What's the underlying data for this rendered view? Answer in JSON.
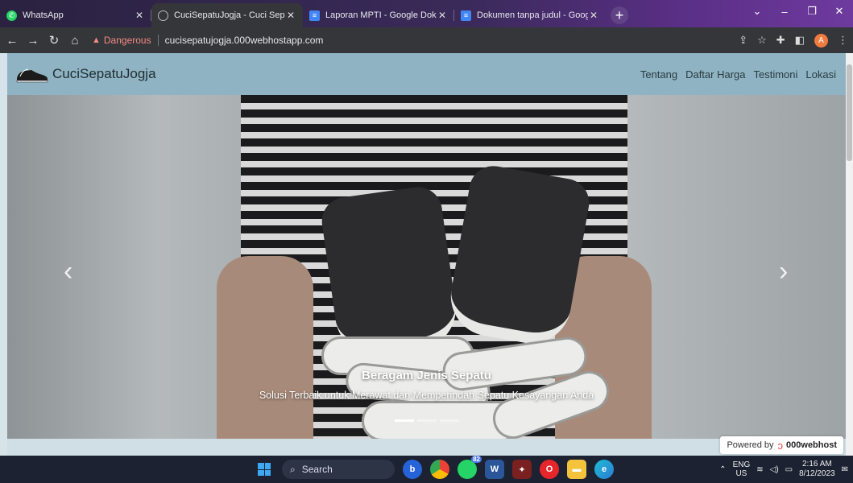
{
  "browser": {
    "tabs": [
      {
        "title": "WhatsApp",
        "icon": "whatsapp-icon",
        "icon_color": "#25d366"
      },
      {
        "title": "CuciSepatuJogja - Cuci Sepatu Pr",
        "icon": "globe-icon",
        "icon_color": "#9aa0a6",
        "active": true
      },
      {
        "title": "Laporan MPTI - Google Dokumen",
        "icon": "google-docs-icon",
        "icon_color": "#4285f4"
      },
      {
        "title": "Dokumen tanpa judul - Google D",
        "icon": "google-docs-icon",
        "icon_color": "#4285f4"
      }
    ],
    "security_label": "Dangerous",
    "url": "cucisepatujogja.000webhostapp.com",
    "profile_initial": "A"
  },
  "site": {
    "brand": "CuciSepatuJogja",
    "nav": [
      "Tentang",
      "Daftar Harga",
      "Testimoni",
      "Lokasi"
    ],
    "carousel": {
      "title": "Beragam Jenis Sepatu",
      "subtitle": "Solusi Terbaik untuk Merawat dan Memperindah Sepatu Kesayangan Anda",
      "slide_count": 3,
      "active_slide": 1,
      "prev_label": "‹",
      "next_label": "›"
    },
    "powered_by": "Powered by",
    "host_brand": "000webhost"
  },
  "taskbar": {
    "search_placeholder": "Search",
    "lang_top": "ENG",
    "lang_bottom": "US",
    "time": "2:16 AM",
    "date": "8/12/2023",
    "notif_badge": "82"
  }
}
